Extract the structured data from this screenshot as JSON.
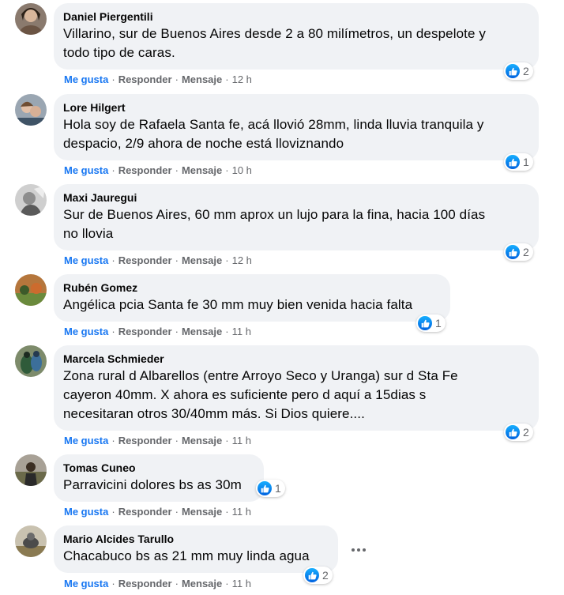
{
  "actions": {
    "like": "Me gusta",
    "reply": "Responder",
    "message": "Mensaje",
    "separator": "·"
  },
  "comments": [
    {
      "author": "Daniel Piergentili",
      "lines": [
        "Villarino, sur de Buenos Aires desde 2 a 80 milímetros, un despelote y",
        "todo tipo de caras."
      ],
      "time": "12 h",
      "reactions": "2"
    },
    {
      "author": "Lore Hilgert",
      "lines": [
        "Hola soy de Rafaela Santa fe, acá llovió 28mm, linda lluvia tranquila y",
        "despacio, 2/9 ahora de noche está lloviznando"
      ],
      "time": "10 h",
      "reactions": "1"
    },
    {
      "author": "Maxi Jauregui",
      "lines": [
        "Sur de Buenos Aires, 60 mm aprox un lujo para la fina, hacia 100 días",
        "no llovia"
      ],
      "time": "12 h",
      "reactions": "2"
    },
    {
      "author": "Rubén Gomez",
      "lines": [
        "Angélica pcia Santa fe 30 mm muy bien venida hacia falta"
      ],
      "time": "11 h",
      "reactions": "1"
    },
    {
      "author": "Marcela Schmieder",
      "lines": [
        "Zona rural d Albarellos (entre Arroyo Seco y Uranga) sur d Sta Fe",
        "cayeron 40mm. X ahora es suficiente pero d aquí a 15dias s",
        "necesitaran otros 30/40mm más. Si Dios quiere...."
      ],
      "time": "11 h",
      "reactions": "2"
    },
    {
      "author": "Tomas Cuneo",
      "lines": [
        "Parravicini dolores bs as 30m"
      ],
      "time": "11 h",
      "reactions": "1"
    },
    {
      "author": "Mario Alcides Tarullo",
      "lines": [
        "Chacabuco bs as 21 mm muy linda agua"
      ],
      "time": "11 h",
      "reactions": "2"
    }
  ],
  "icons": {
    "reaction": "like-thumbs-up-icon",
    "more": "more-options-icon"
  },
  "colors": {
    "bubble": "#f0f2f5",
    "like_blue": "#1877f2",
    "meta_gray": "#65676b"
  }
}
